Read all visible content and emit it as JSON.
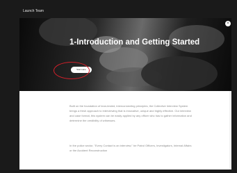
{
  "window": {
    "title": "Launch Team"
  },
  "hero": {
    "title": "1-Introduction and Getting Started",
    "start_label": "Start Here"
  },
  "close": {
    "glyph": "×"
  },
  "body": {
    "paragraph_1": "Built on the foundation of lean-tested, interconnecting principles, the Collective Interview System brings a fresh approach to interviewing that is innovative, unique and highly effective. Our interview and case format, this system can be easily applied by any officer who has to gather information and determine the credibility of witnesses.",
    "paragraph_2": "In the police sector, \"Every Contact is an interview,\" be Patrol Officers, Investigators, Internal Affairs or the Accident Reconstruction"
  },
  "colors": {
    "annotation": "#d4202a",
    "frame": "#1a1a1a"
  }
}
